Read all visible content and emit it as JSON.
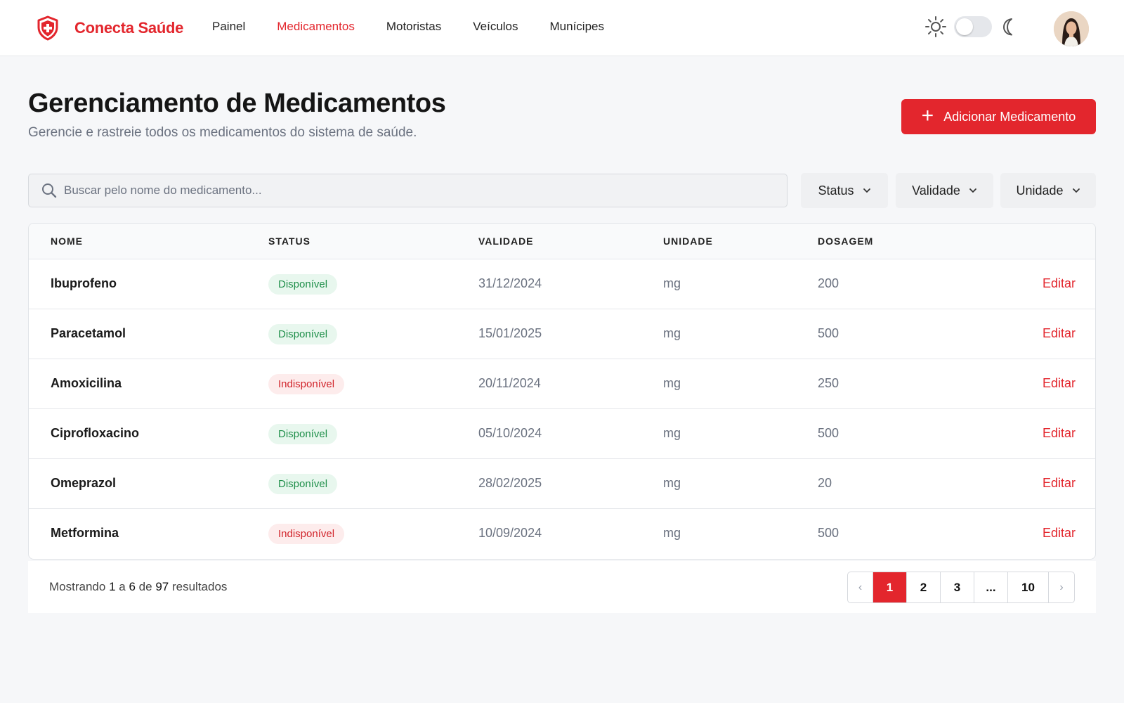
{
  "app": {
    "name": "Conecta Saúde",
    "brand_color": "#e3262d"
  },
  "nav": {
    "items": [
      {
        "label": "Painel",
        "active": false
      },
      {
        "label": "Medicamentos",
        "active": true
      },
      {
        "label": "Motoristas",
        "active": false
      },
      {
        "label": "Veículos",
        "active": false
      },
      {
        "label": "Munícipes",
        "active": false
      }
    ]
  },
  "theme_toggle": {
    "mode": "light",
    "icons": [
      "sun-icon",
      "moon-icon"
    ]
  },
  "page": {
    "title": "Gerenciamento de Medicamentos",
    "subtitle": "Gerencie e rastreie todos os medicamentos do sistema de saúde.",
    "add_button": "Adicionar Medicamento"
  },
  "filters": {
    "search_placeholder": "Buscar pelo nome do medicamento...",
    "status": "Status",
    "validade": "Validade",
    "unidade": "Unidade"
  },
  "table": {
    "headers": [
      "Nome",
      "Status",
      "Validade",
      "Unidade",
      "Dosagem"
    ],
    "edit_label": "Editar",
    "rows": [
      {
        "nome": "Ibuprofeno",
        "status": "Disponível",
        "validade": "31/12/2024",
        "unidade": "mg",
        "dosagem": "200"
      },
      {
        "nome": "Paracetamol",
        "status": "Disponível",
        "validade": "15/01/2025",
        "unidade": "mg",
        "dosagem": "500"
      },
      {
        "nome": "Amoxicilina",
        "status": "Indisponível",
        "validade": "20/11/2024",
        "unidade": "mg",
        "dosagem": "250"
      },
      {
        "nome": "Ciprofloxacino",
        "status": "Disponível",
        "validade": "05/10/2024",
        "unidade": "mg",
        "dosagem": "500"
      },
      {
        "nome": "Omeprazol",
        "status": "Disponível",
        "validade": "28/02/2025",
        "unidade": "mg",
        "dosagem": "20"
      },
      {
        "nome": "Metformina",
        "status": "Indisponível",
        "validade": "10/09/2024",
        "unidade": "mg",
        "dosagem": "500"
      }
    ]
  },
  "footer": {
    "prefix": "Mostrando",
    "from": "1",
    "sep_a": "a",
    "to": "6",
    "sep_de": "de",
    "total": "97",
    "suffix": "resultados"
  },
  "pagination": {
    "prev": "‹",
    "pages": [
      "1",
      "2",
      "3",
      "...",
      "10"
    ],
    "current": "1",
    "next": "›"
  }
}
